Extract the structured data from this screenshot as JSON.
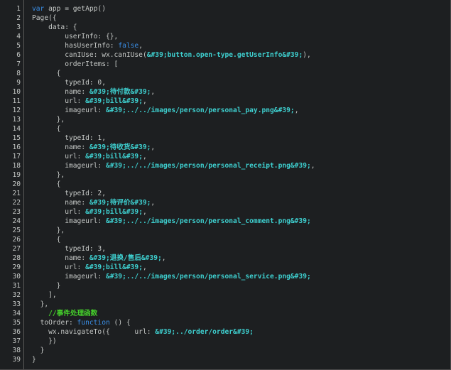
{
  "editor": {
    "lines": [
      {
        "n": "1",
        "indent": "",
        "tokens": [
          {
            "t": "kw",
            "v": "var"
          },
          {
            "t": "pl",
            "v": " app = getApp()"
          }
        ]
      },
      {
        "n": "2",
        "indent": "",
        "tokens": [
          {
            "t": "pl",
            "v": "Page({"
          }
        ]
      },
      {
        "n": "3",
        "indent": "    ",
        "tokens": [
          {
            "t": "pl",
            "v": "data: {"
          }
        ]
      },
      {
        "n": "4",
        "indent": "        ",
        "tokens": [
          {
            "t": "pl",
            "v": "userInfo: {},"
          }
        ]
      },
      {
        "n": "5",
        "indent": "        ",
        "tokens": [
          {
            "t": "pl",
            "v": "hasUserInfo: "
          },
          {
            "t": "bool",
            "v": "false"
          },
          {
            "t": "pl",
            "v": ","
          }
        ]
      },
      {
        "n": "6",
        "indent": "        ",
        "tokens": [
          {
            "t": "pl",
            "v": "canIUse: wx.canIUse("
          },
          {
            "t": "str",
            "v": "&#39;button.open-type.getUserInfo&#39;"
          },
          {
            "t": "pl",
            "v": "),"
          }
        ]
      },
      {
        "n": "7",
        "indent": "        ",
        "tokens": [
          {
            "t": "pl",
            "v": "orderItems: ["
          }
        ]
      },
      {
        "n": "8",
        "indent": "      ",
        "tokens": [
          {
            "t": "pl",
            "v": "{"
          }
        ]
      },
      {
        "n": "9",
        "indent": "        ",
        "tokens": [
          {
            "t": "pl",
            "v": "typeId: 0,"
          }
        ]
      },
      {
        "n": "10",
        "indent": "        ",
        "tokens": [
          {
            "t": "pl",
            "v": "name: "
          },
          {
            "t": "str",
            "v": "&#39;待付款&#39;"
          },
          {
            "t": "pl",
            "v": ","
          }
        ]
      },
      {
        "n": "11",
        "indent": "        ",
        "tokens": [
          {
            "t": "pl",
            "v": "url: "
          },
          {
            "t": "str",
            "v": "&#39;bill&#39;"
          },
          {
            "t": "pl",
            "v": ","
          }
        ]
      },
      {
        "n": "12",
        "indent": "        ",
        "tokens": [
          {
            "t": "pl",
            "v": "imageurl: "
          },
          {
            "t": "str",
            "v": "&#39;../../images/person/personal_pay.png&#39;"
          },
          {
            "t": "pl",
            "v": ","
          }
        ]
      },
      {
        "n": "13",
        "indent": "      ",
        "tokens": [
          {
            "t": "pl",
            "v": "},"
          }
        ]
      },
      {
        "n": "14",
        "indent": "      ",
        "tokens": [
          {
            "t": "pl",
            "v": "{"
          }
        ]
      },
      {
        "n": "15",
        "indent": "        ",
        "tokens": [
          {
            "t": "pl",
            "v": "typeId: 1,"
          }
        ]
      },
      {
        "n": "16",
        "indent": "        ",
        "tokens": [
          {
            "t": "pl",
            "v": "name: "
          },
          {
            "t": "str",
            "v": "&#39;待收货&#39;"
          },
          {
            "t": "pl",
            "v": ","
          }
        ]
      },
      {
        "n": "17",
        "indent": "        ",
        "tokens": [
          {
            "t": "pl",
            "v": "url: "
          },
          {
            "t": "str",
            "v": "&#39;bill&#39;"
          },
          {
            "t": "pl",
            "v": ","
          }
        ]
      },
      {
        "n": "18",
        "indent": "        ",
        "tokens": [
          {
            "t": "pl",
            "v": "imageurl: "
          },
          {
            "t": "str",
            "v": "&#39;../../images/person/personal_receipt.png&#39;"
          },
          {
            "t": "pl",
            "v": ","
          }
        ]
      },
      {
        "n": "19",
        "indent": "      ",
        "tokens": [
          {
            "t": "pl",
            "v": "},"
          }
        ]
      },
      {
        "n": "20",
        "indent": "      ",
        "tokens": [
          {
            "t": "pl",
            "v": "{"
          }
        ]
      },
      {
        "n": "21",
        "indent": "        ",
        "tokens": [
          {
            "t": "pl",
            "v": "typeId: 2,"
          }
        ]
      },
      {
        "n": "22",
        "indent": "        ",
        "tokens": [
          {
            "t": "pl",
            "v": "name: "
          },
          {
            "t": "str",
            "v": "&#39;待评价&#39;"
          },
          {
            "t": "pl",
            "v": ","
          }
        ]
      },
      {
        "n": "23",
        "indent": "        ",
        "tokens": [
          {
            "t": "pl",
            "v": "url: "
          },
          {
            "t": "str",
            "v": "&#39;bill&#39;"
          },
          {
            "t": "pl",
            "v": ","
          }
        ]
      },
      {
        "n": "24",
        "indent": "        ",
        "tokens": [
          {
            "t": "pl",
            "v": "imageurl: "
          },
          {
            "t": "str",
            "v": "&#39;../../images/person/personal_comment.png&#39;"
          }
        ]
      },
      {
        "n": "25",
        "indent": "      ",
        "tokens": [
          {
            "t": "pl",
            "v": "},"
          }
        ]
      },
      {
        "n": "26",
        "indent": "      ",
        "tokens": [
          {
            "t": "pl",
            "v": "{"
          }
        ]
      },
      {
        "n": "27",
        "indent": "        ",
        "tokens": [
          {
            "t": "pl",
            "v": "typeId: 3,"
          }
        ]
      },
      {
        "n": "28",
        "indent": "        ",
        "tokens": [
          {
            "t": "pl",
            "v": "name: "
          },
          {
            "t": "str",
            "v": "&#39;退换/售后&#39;"
          },
          {
            "t": "pl",
            "v": ","
          }
        ]
      },
      {
        "n": "29",
        "indent": "        ",
        "tokens": [
          {
            "t": "pl",
            "v": "url: "
          },
          {
            "t": "str",
            "v": "&#39;bill&#39;"
          },
          {
            "t": "pl",
            "v": ","
          }
        ]
      },
      {
        "n": "30",
        "indent": "        ",
        "tokens": [
          {
            "t": "pl",
            "v": "imageurl: "
          },
          {
            "t": "str",
            "v": "&#39;../../images/person/personal_service.png&#39;"
          }
        ]
      },
      {
        "n": "31",
        "indent": "      ",
        "tokens": [
          {
            "t": "pl",
            "v": "}"
          }
        ]
      },
      {
        "n": "32",
        "indent": "    ",
        "tokens": [
          {
            "t": "pl",
            "v": "],"
          }
        ]
      },
      {
        "n": "33",
        "indent": "  ",
        "tokens": [
          {
            "t": "pl",
            "v": "},"
          }
        ]
      },
      {
        "n": "34",
        "indent": "    ",
        "tokens": [
          {
            "t": "cm",
            "v": "//事件处理函数"
          }
        ]
      },
      {
        "n": "35",
        "indent": "  ",
        "tokens": [
          {
            "t": "pl",
            "v": "toOrder: "
          },
          {
            "t": "kw",
            "v": "function"
          },
          {
            "t": "pl",
            "v": " () {"
          }
        ]
      },
      {
        "n": "36",
        "indent": "    ",
        "tokens": [
          {
            "t": "pl",
            "v": "wx.navigateTo({      url: "
          },
          {
            "t": "str",
            "v": "&#39;../order/order&#39;"
          }
        ]
      },
      {
        "n": "37",
        "indent": "    ",
        "tokens": [
          {
            "t": "pl",
            "v": "})"
          }
        ]
      },
      {
        "n": "38",
        "indent": "  ",
        "tokens": [
          {
            "t": "pl",
            "v": "}"
          }
        ]
      },
      {
        "n": "39",
        "indent": "",
        "tokens": [
          {
            "t": "pl",
            "v": "}"
          }
        ]
      }
    ]
  },
  "colors": {
    "background": "#1d1f21",
    "keyword": "#3a8ee6",
    "string": "#3ecfcf",
    "comment": "#45d02b",
    "plain": "#c5c8c6"
  }
}
